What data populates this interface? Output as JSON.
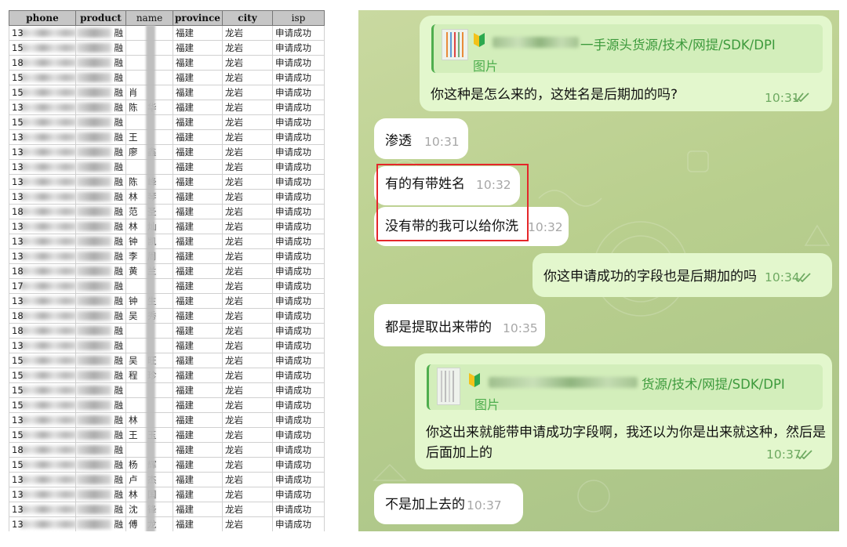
{
  "sheet": {
    "headers": [
      "phone",
      "product",
      "name",
      "province",
      "city",
      "isp"
    ],
    "rows": [
      {
        "phone_prefix": "13",
        "product": "融",
        "surname": "",
        "given": "",
        "province": "福建",
        "city": "龙岩",
        "isp": "申请成功"
      },
      {
        "phone_prefix": "15",
        "product": "融",
        "surname": "",
        "given": "",
        "province": "福建",
        "city": "龙岩",
        "isp": "申请成功"
      },
      {
        "phone_prefix": "18",
        "product": "融",
        "surname": "",
        "given": "",
        "province": "福建",
        "city": "龙岩",
        "isp": "申请成功"
      },
      {
        "phone_prefix": "15",
        "product": "融",
        "surname": "",
        "given": "",
        "province": "福建",
        "city": "龙岩",
        "isp": "申请成功"
      },
      {
        "phone_prefix": "15",
        "product": "融",
        "surname": "肖",
        "given": "",
        "province": "福建",
        "city": "龙岩",
        "isp": "申请成功"
      },
      {
        "phone_prefix": "13",
        "product": "融",
        "surname": "陈",
        "given": "华",
        "province": "福建",
        "city": "龙岩",
        "isp": "申请成功"
      },
      {
        "phone_prefix": "15",
        "product": "融",
        "surname": "",
        "given": "",
        "province": "福建",
        "city": "龙岩",
        "isp": "申请成功"
      },
      {
        "phone_prefix": "13",
        "product": "融",
        "surname": "王",
        "given": "",
        "province": "福建",
        "city": "龙岩",
        "isp": "申请成功"
      },
      {
        "phone_prefix": "13",
        "product": "融",
        "surname": "廖",
        "given": "鑫",
        "province": "福建",
        "city": "龙岩",
        "isp": "申请成功"
      },
      {
        "phone_prefix": "13",
        "product": "融",
        "surname": "",
        "given": "",
        "province": "福建",
        "city": "龙岩",
        "isp": "申请成功"
      },
      {
        "phone_prefix": "13",
        "product": "融",
        "surname": "陈",
        "given": "峰",
        "province": "福建",
        "city": "龙岩",
        "isp": "申请成功"
      },
      {
        "phone_prefix": "13",
        "product": "融",
        "surname": "林",
        "given": "琴",
        "province": "福建",
        "city": "龙岩",
        "isp": "申请成功"
      },
      {
        "phone_prefix": "18",
        "product": "融",
        "surname": "范",
        "given": "圣",
        "province": "福建",
        "city": "龙岩",
        "isp": "申请成功"
      },
      {
        "phone_prefix": "13",
        "product": "融",
        "surname": "林",
        "given": "灿",
        "province": "福建",
        "city": "龙岩",
        "isp": "申请成功"
      },
      {
        "phone_prefix": "13",
        "product": "融",
        "surname": "钟",
        "given": "凯",
        "province": "福建",
        "city": "龙岩",
        "isp": "申请成功"
      },
      {
        "phone_prefix": "13",
        "product": "融",
        "surname": "李",
        "given": "周",
        "province": "福建",
        "city": "龙岩",
        "isp": "申请成功"
      },
      {
        "phone_prefix": "18",
        "product": "融",
        "surname": "黄",
        "given": "兰",
        "province": "福建",
        "city": "龙岩",
        "isp": "申请成功"
      },
      {
        "phone_prefix": "17",
        "product": "融",
        "surname": "",
        "given": "",
        "province": "福建",
        "city": "龙岩",
        "isp": "申请成功"
      },
      {
        "phone_prefix": "13",
        "product": "融",
        "surname": "钟",
        "given": "生",
        "province": "福建",
        "city": "龙岩",
        "isp": "申请成功"
      },
      {
        "phone_prefix": "18",
        "product": "融",
        "surname": "吴",
        "given": "秀",
        "province": "福建",
        "city": "龙岩",
        "isp": "申请成功"
      },
      {
        "phone_prefix": "18",
        "product": "融",
        "surname": "",
        "given": "",
        "province": "福建",
        "city": "龙岩",
        "isp": "申请成功"
      },
      {
        "phone_prefix": "13",
        "product": "融",
        "surname": "",
        "given": "",
        "province": "福建",
        "city": "龙岩",
        "isp": "申请成功"
      },
      {
        "phone_prefix": "15",
        "product": "融",
        "surname": "吴",
        "given": "旺",
        "province": "福建",
        "city": "龙岩",
        "isp": "申请成功"
      },
      {
        "phone_prefix": "15",
        "product": "融",
        "surname": "程",
        "given": "珍",
        "province": "福建",
        "city": "龙岩",
        "isp": "申请成功"
      },
      {
        "phone_prefix": "15",
        "product": "融",
        "surname": "",
        "given": "",
        "province": "福建",
        "city": "龙岩",
        "isp": "申请成功"
      },
      {
        "phone_prefix": "15",
        "product": "融",
        "surname": "",
        "given": "",
        "province": "福建",
        "city": "龙岩",
        "isp": "申请成功"
      },
      {
        "phone_prefix": "13",
        "product": "融",
        "surname": "林",
        "given": "",
        "province": "福建",
        "city": "龙岩",
        "isp": "申请成功"
      },
      {
        "phone_prefix": "15",
        "product": "融",
        "surname": "王",
        "given": "玉",
        "province": "福建",
        "city": "龙岩",
        "isp": "申请成功"
      },
      {
        "phone_prefix": "18",
        "product": "融",
        "surname": "",
        "given": "",
        "province": "福建",
        "city": "龙岩",
        "isp": "申请成功"
      },
      {
        "phone_prefix": "15",
        "product": "融",
        "surname": "杨",
        "given": "辉",
        "province": "福建",
        "city": "龙岩",
        "isp": "申请成功"
      },
      {
        "phone_prefix": "13",
        "product": "融",
        "surname": "卢",
        "given": "杰",
        "province": "福建",
        "city": "龙岩",
        "isp": "申请成功"
      },
      {
        "phone_prefix": "13",
        "product": "融",
        "surname": "林",
        "given": "国",
        "province": "福建",
        "city": "龙岩",
        "isp": "申请成功"
      },
      {
        "phone_prefix": "13",
        "product": "融",
        "surname": "沈",
        "given": "锋",
        "province": "福建",
        "city": "龙岩",
        "isp": "申请成功"
      },
      {
        "phone_prefix": "13",
        "product": "融",
        "surname": "傅",
        "given": "龙",
        "province": "福建",
        "city": "龙岩",
        "isp": "申请成功"
      }
    ]
  },
  "chat": {
    "colors": {
      "incoming": "#ffffff",
      "outgoing": "#e3f7cd",
      "accent": "#4fae4e",
      "highlight": "#e5262a"
    },
    "quote1": {
      "icon": "beginner-leaf-icon",
      "title": "一手源头货源/技术/网提/SDK/DPI",
      "subtitle": "图片"
    },
    "quote2": {
      "icon": "beginner-leaf-icon",
      "title": "货源/技术/网提/SDK/DPI",
      "subtitle": "图片"
    },
    "messages": {
      "m1": {
        "text": "你这种是怎么来的，这姓名是后期加的吗?",
        "time": "10:31"
      },
      "m2": {
        "text": "渗透",
        "time": "10:31"
      },
      "m3": {
        "text": "有的有带姓名",
        "time": "10:32"
      },
      "m4": {
        "text": "没有带的我可以给你洗",
        "time": "10:32"
      },
      "m5": {
        "text": "你这申请成功的字段也是后期加的吗",
        "time": "10:34"
      },
      "m6": {
        "text": "都是提取出来带的",
        "time": "10:35"
      },
      "m7": {
        "line1": "你这出来就能带申请成功字段啊，我还以为你是出来就这种，然后是",
        "line2": "后面加上的",
        "time": "10:37"
      },
      "m8": {
        "text": "不是加上去的",
        "time": "10:37"
      }
    }
  }
}
